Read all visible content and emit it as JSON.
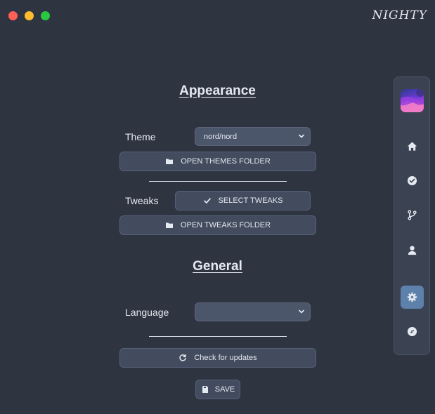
{
  "window": {
    "brand": "NIGHTY"
  },
  "appearance": {
    "title": "Appearance",
    "theme_label": "Theme",
    "theme_value": "nord/nord",
    "open_themes_label": "OPEN THEMES FOLDER",
    "tweaks_label": "Tweaks",
    "select_tweaks_label": "SELECT TWEAKS",
    "open_tweaks_label": "OPEN TWEAKS FOLDER"
  },
  "general": {
    "title": "General",
    "language_label": "Language",
    "language_value": "",
    "check_updates_label": "Check for updates",
    "save_label": "SAVE"
  },
  "sidebar": {
    "items": [
      {
        "icon": "home-icon"
      },
      {
        "icon": "check-circle-icon"
      },
      {
        "icon": "git-branch-icon"
      },
      {
        "icon": "user-icon"
      },
      {
        "icon": "gear-icon",
        "active": true
      },
      {
        "icon": "compass-icon"
      }
    ]
  },
  "colors": {
    "background": "#2e3440",
    "accent": "#5e81ac",
    "button": "#434c5e",
    "text": "#e5e9f0"
  }
}
